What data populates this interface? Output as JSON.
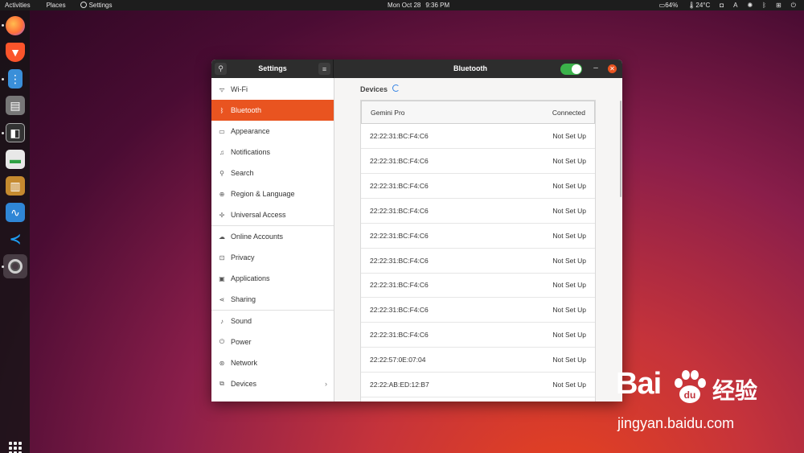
{
  "topbar": {
    "activities": "Activities",
    "places": "Places",
    "app_menu": "Settings",
    "date": "Mon Oct 28",
    "time": "9:36 PM",
    "battery": "64%",
    "temperature": "24°C",
    "input_indicator": "A"
  },
  "dock": {
    "apps": [
      {
        "name": "firefox-icon",
        "color": "#ff7139"
      },
      {
        "name": "brave-icon",
        "color": "#fb542b"
      },
      {
        "name": "files-icon",
        "color": "#3a8fd9"
      },
      {
        "name": "installer-icon",
        "color": "#c0392b"
      },
      {
        "name": "remote-desktop-icon",
        "color": "#444444"
      },
      {
        "name": "switcher-icon",
        "color": "#2ea043"
      },
      {
        "name": "book-icon",
        "color": "#c58a2f"
      },
      {
        "name": "system-monitor-icon",
        "color": "#2f86d6"
      },
      {
        "name": "vscode-icon",
        "color": "#1f7ad6"
      },
      {
        "name": "settings-icon",
        "color": "#bbbbbb"
      }
    ]
  },
  "window": {
    "sidebar_title": "Settings",
    "panel_title": "Bluetooth",
    "bluetooth_enabled": true,
    "sidebar": [
      {
        "label": "Wi-Fi",
        "icon": "wifi-icon",
        "glyph": "ᯤ"
      },
      {
        "label": "Bluetooth",
        "icon": "bluetooth-icon",
        "glyph": "ᛒ"
      },
      {
        "label": "Appearance",
        "icon": "monitor-icon",
        "glyph": "▭"
      },
      {
        "label": "Notifications",
        "icon": "bell-icon",
        "glyph": "♫"
      },
      {
        "label": "Search",
        "icon": "search-icon",
        "glyph": "⚲"
      },
      {
        "label": "Region & Language",
        "icon": "globe-icon",
        "glyph": "⊕"
      },
      {
        "label": "Universal Access",
        "icon": "accessibility-icon",
        "glyph": "✢"
      },
      {
        "label": "Online Accounts",
        "icon": "cloud-icon",
        "glyph": "☁"
      },
      {
        "label": "Privacy",
        "icon": "lock-icon",
        "glyph": "⊡"
      },
      {
        "label": "Applications",
        "icon": "applications-icon",
        "glyph": "▣"
      },
      {
        "label": "Sharing",
        "icon": "share-icon",
        "glyph": "⋖"
      },
      {
        "label": "Sound",
        "icon": "music-note-icon",
        "glyph": "♪"
      },
      {
        "label": "Power",
        "icon": "power-icon",
        "glyph": "⏻"
      },
      {
        "label": "Network",
        "icon": "network-icon",
        "glyph": "⊛"
      },
      {
        "label": "Devices",
        "icon": "devices-icon",
        "glyph": "⧉"
      }
    ],
    "devices_heading": "Devices",
    "devices": [
      {
        "name": "Gemini Pro",
        "status": "Connected"
      },
      {
        "name": "22:22:31:BC:F4:C6",
        "status": "Not Set Up"
      },
      {
        "name": "22:22:31:BC:F4:C6",
        "status": "Not Set Up"
      },
      {
        "name": "22:22:31:BC:F4:C6",
        "status": "Not Set Up"
      },
      {
        "name": "22:22:31:BC:F4:C6",
        "status": "Not Set Up"
      },
      {
        "name": "22:22:31:BC:F4:C6",
        "status": "Not Set Up"
      },
      {
        "name": "22:22:31:BC:F4:C6",
        "status": "Not Set Up"
      },
      {
        "name": "22:22:31:BC:F4:C6",
        "status": "Not Set Up"
      },
      {
        "name": "22:22:31:BC:F4:C6",
        "status": "Not Set Up"
      },
      {
        "name": "22:22:31:BC:F4:C6",
        "status": "Not Set Up"
      },
      {
        "name": "22:22:57:0E:07:04",
        "status": "Not Set Up"
      },
      {
        "name": "22:22:AB:ED:12:B7",
        "status": "Not Set Up"
      }
    ]
  },
  "watermark": {
    "logo_text": "Bai",
    "logo_cn": "经验",
    "url": "jingyan.baidu.com"
  }
}
